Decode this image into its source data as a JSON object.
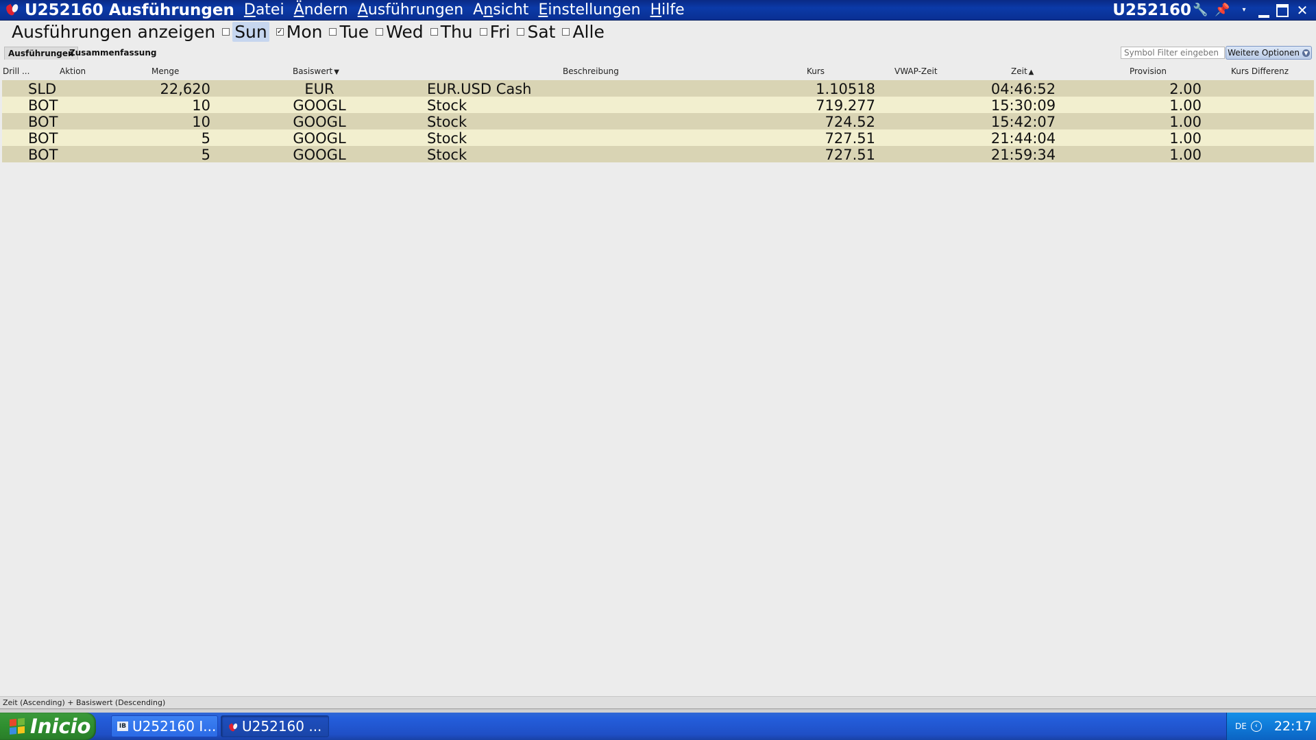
{
  "window": {
    "title": "U252160 Ausführungen",
    "account": "U252160"
  },
  "menu": [
    {
      "pre": "",
      "ul": "D",
      "post": "atei"
    },
    {
      "pre": "",
      "ul": "Ä",
      "post": "ndern"
    },
    {
      "pre": "",
      "ul": "A",
      "post": "usführungen"
    },
    {
      "pre": "A",
      "ul": "n",
      "post": "sicht"
    },
    {
      "pre": "",
      "ul": "E",
      "post": "instellungen"
    },
    {
      "pre": "",
      "ul": "H",
      "post": "ilfe"
    }
  ],
  "days": {
    "label": "Ausführungen anzeigen",
    "items": [
      {
        "label": "Sun",
        "checked": false,
        "selected": true
      },
      {
        "label": "Mon",
        "checked": true,
        "selected": false
      },
      {
        "label": "Tue",
        "checked": false,
        "selected": false
      },
      {
        "label": "Wed",
        "checked": false,
        "selected": false
      },
      {
        "label": "Thu",
        "checked": false,
        "selected": false
      },
      {
        "label": "Fri",
        "checked": false,
        "selected": false
      },
      {
        "label": "Sat",
        "checked": false,
        "selected": false
      },
      {
        "label": "Alle",
        "checked": false,
        "selected": false
      }
    ]
  },
  "tabs": {
    "executions": "Ausführungen",
    "summary": "Zusammenfassung"
  },
  "filter": {
    "placeholder": "Symbol Filter eingeben"
  },
  "more_options_label": "Weitere Optionen",
  "table": {
    "headers": {
      "drill": "Drill ...",
      "aktion": "Aktion",
      "menge": "Menge",
      "basiswert": "Basiswert",
      "beschreibung": "Beschreibung",
      "kurs": "Kurs",
      "vwap": "VWAP-Zeit",
      "zeit": "Zeit",
      "provision": "Provision",
      "kurs_diff": "Kurs Differenz"
    },
    "rows": [
      {
        "aktion": "SLD",
        "menge": "22,620",
        "basiswert": "EUR",
        "beschreibung": "EUR.USD Cash",
        "kurs": "1.10518",
        "zeit": "04:46:52",
        "provision": "2.00"
      },
      {
        "aktion": "BOT",
        "menge": "10",
        "basiswert": "GOOGL",
        "beschreibung": "Stock",
        "kurs": "719.277",
        "zeit": "15:30:09",
        "provision": "1.00"
      },
      {
        "aktion": "BOT",
        "menge": "10",
        "basiswert": "GOOGL",
        "beschreibung": "Stock",
        "kurs": "724.52",
        "zeit": "15:42:07",
        "provision": "1.00"
      },
      {
        "aktion": "BOT",
        "menge": "5",
        "basiswert": "GOOGL",
        "beschreibung": "Stock",
        "kurs": "727.51",
        "zeit": "21:44:04",
        "provision": "1.00"
      },
      {
        "aktion": "BOT",
        "menge": "5",
        "basiswert": "GOOGL",
        "beschreibung": "Stock",
        "kurs": "727.51",
        "zeit": "21:59:34",
        "provision": "1.00"
      }
    ]
  },
  "status_text": "Zeit (Ascending)  +  Basiswert (Descending)",
  "taskbar": {
    "start_label": "Inicio",
    "tasks": [
      {
        "icon": "ib-icon",
        "icon_text": "IB",
        "label": "U252160 I..."
      },
      {
        "icon": "tws-logo-icon",
        "icon_text": "",
        "label": "U252160 ..."
      }
    ],
    "lang": "DE",
    "clock": "22:17"
  }
}
